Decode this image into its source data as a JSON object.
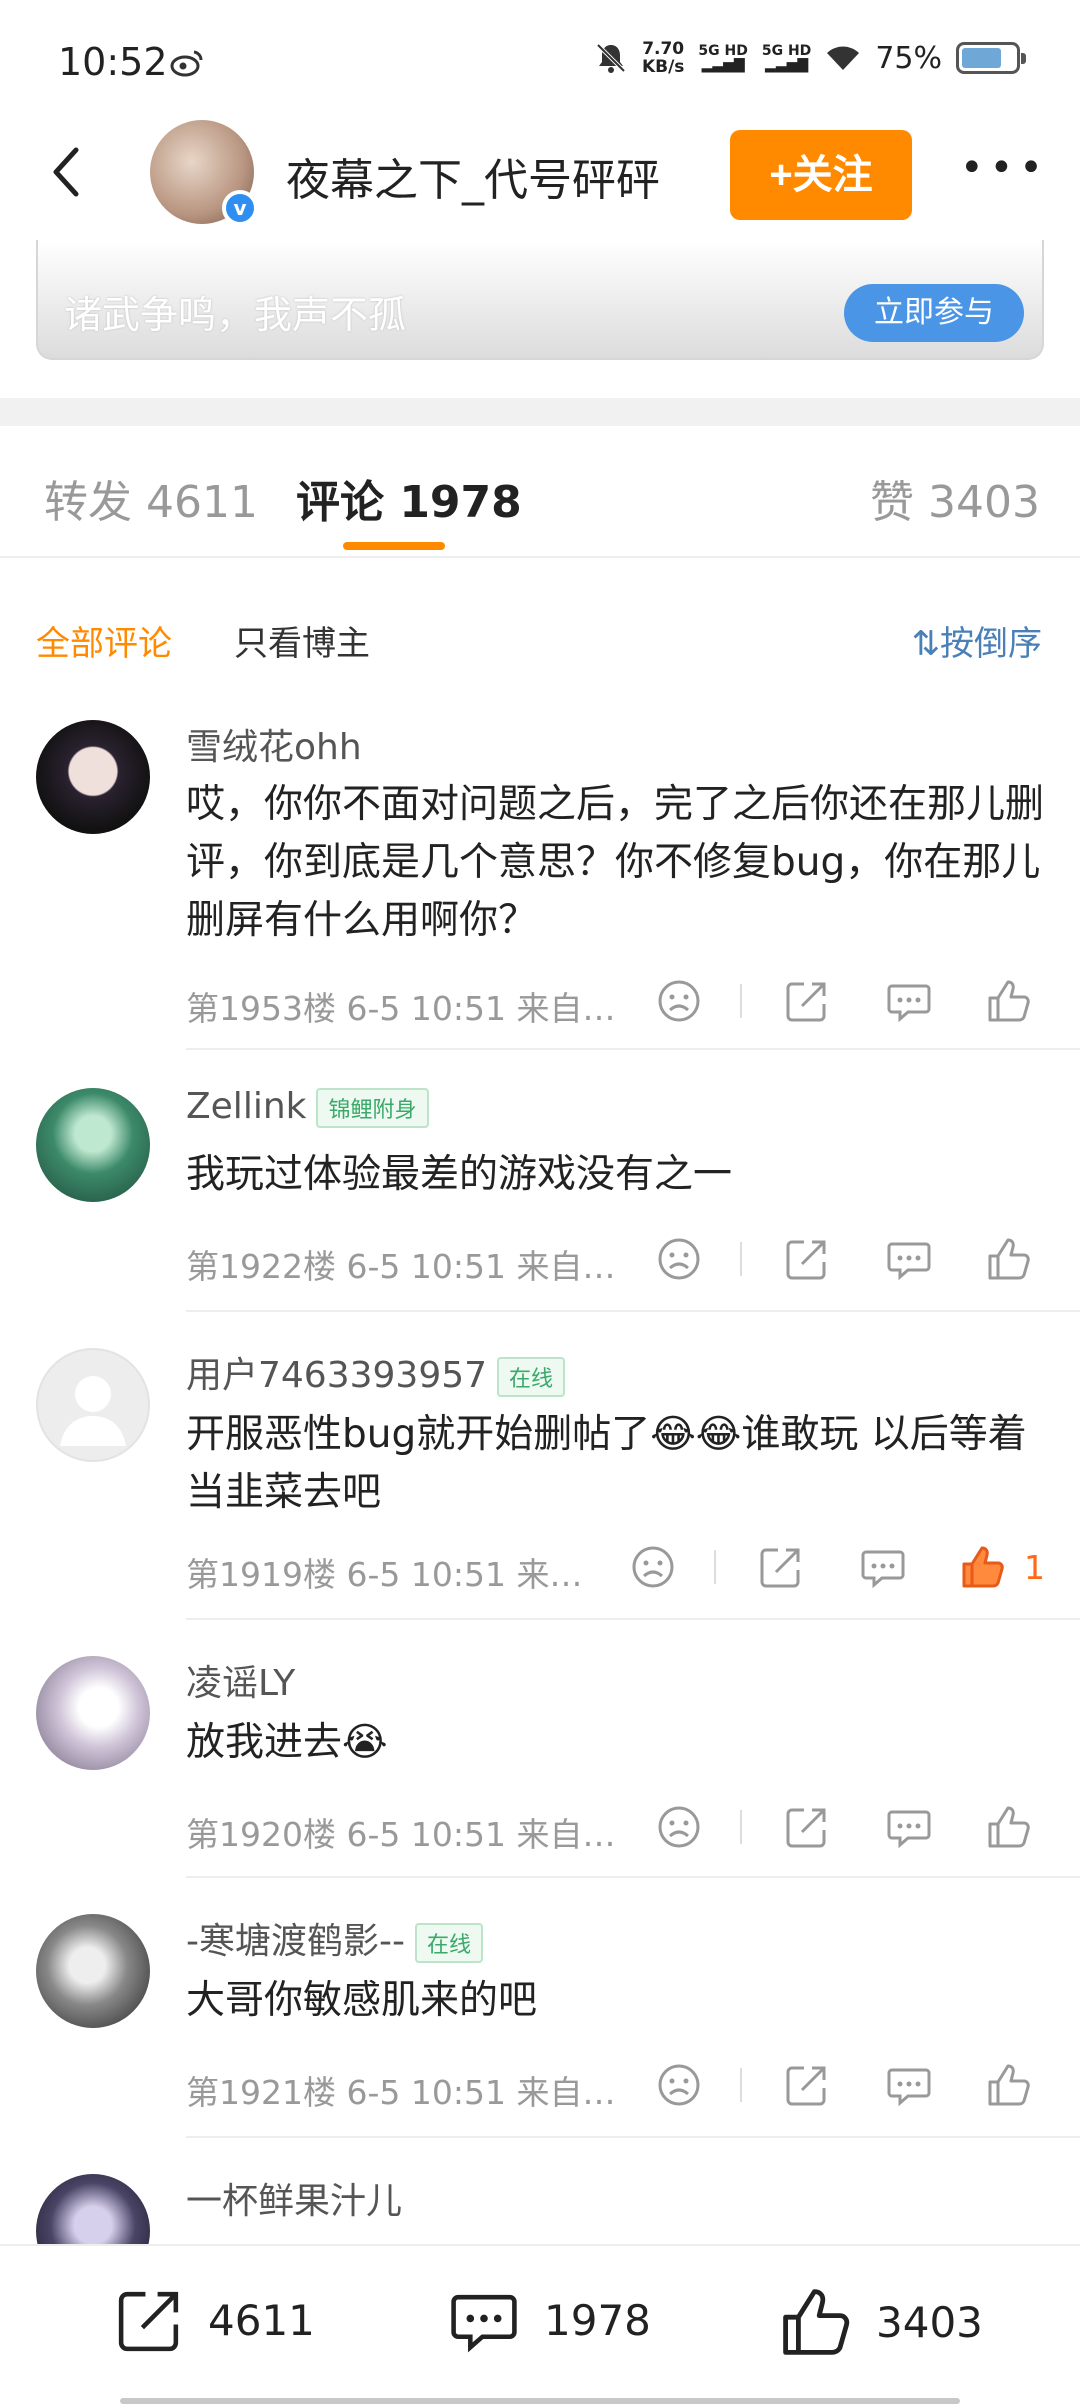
{
  "status": {
    "time": "10:52",
    "speed_top": "7.70",
    "speed_unit": "KB/s",
    "signal1": "5G HD",
    "signal2": "5G HD",
    "battery": "75%",
    "battery_level": 0.75
  },
  "header": {
    "title": "夜幕之下_代号砰砰",
    "follow_label": "+关注",
    "verified_mark": "v"
  },
  "banner": {
    "text": "诸武争鸣，我声不孤",
    "button": "立即参与"
  },
  "tabs": {
    "repost": "转发 4611",
    "comment": "评论 1978",
    "like": "赞 3403"
  },
  "filter": {
    "all": "全部评论",
    "host_only": "只看博主",
    "sort": "按倒序"
  },
  "comments": [
    {
      "name": "雪绒花ohh",
      "badge": "",
      "text": "哎，你你不面对问题之后，完了之后你还在那儿删评，你到底是几个意思？你不修复bug，你在那儿删屏有什么用啊你？",
      "meta": "第1953楼  6-5 10:51  来自…",
      "likes": ""
    },
    {
      "name": "Zellink",
      "badge": "锦鲤附身",
      "text": "我玩过体验最差的游戏没有之一",
      "meta": "第1922楼  6-5 10:51  来自…",
      "likes": ""
    },
    {
      "name": "用户7463393957",
      "badge": "在线",
      "text": "开服恶性bug就开始删帖了😂😂谁敢玩 以后等着当韭菜去吧",
      "meta": "第1919楼  6-5 10:51  来…",
      "likes": "1"
    },
    {
      "name": "凌谣LY",
      "badge": "",
      "text": "放我进去😭",
      "meta": "第1920楼  6-5 10:51  来自…",
      "likes": ""
    },
    {
      "name": "-寒塘渡鹤影--",
      "badge": "在线",
      "text": "大哥你敏感肌来的吧",
      "meta": "第1921楼  6-5 10:51  来自…",
      "likes": ""
    },
    {
      "name": "一杯鲜果汁儿",
      "badge": "",
      "text": "",
      "meta": "",
      "likes": ""
    }
  ],
  "bottom": {
    "repost": "4611",
    "comment": "1978",
    "like": "3403"
  },
  "colors": {
    "accent": "#ff8a00",
    "link": "#4a7fb8",
    "like_active": "#ff6a1a"
  }
}
